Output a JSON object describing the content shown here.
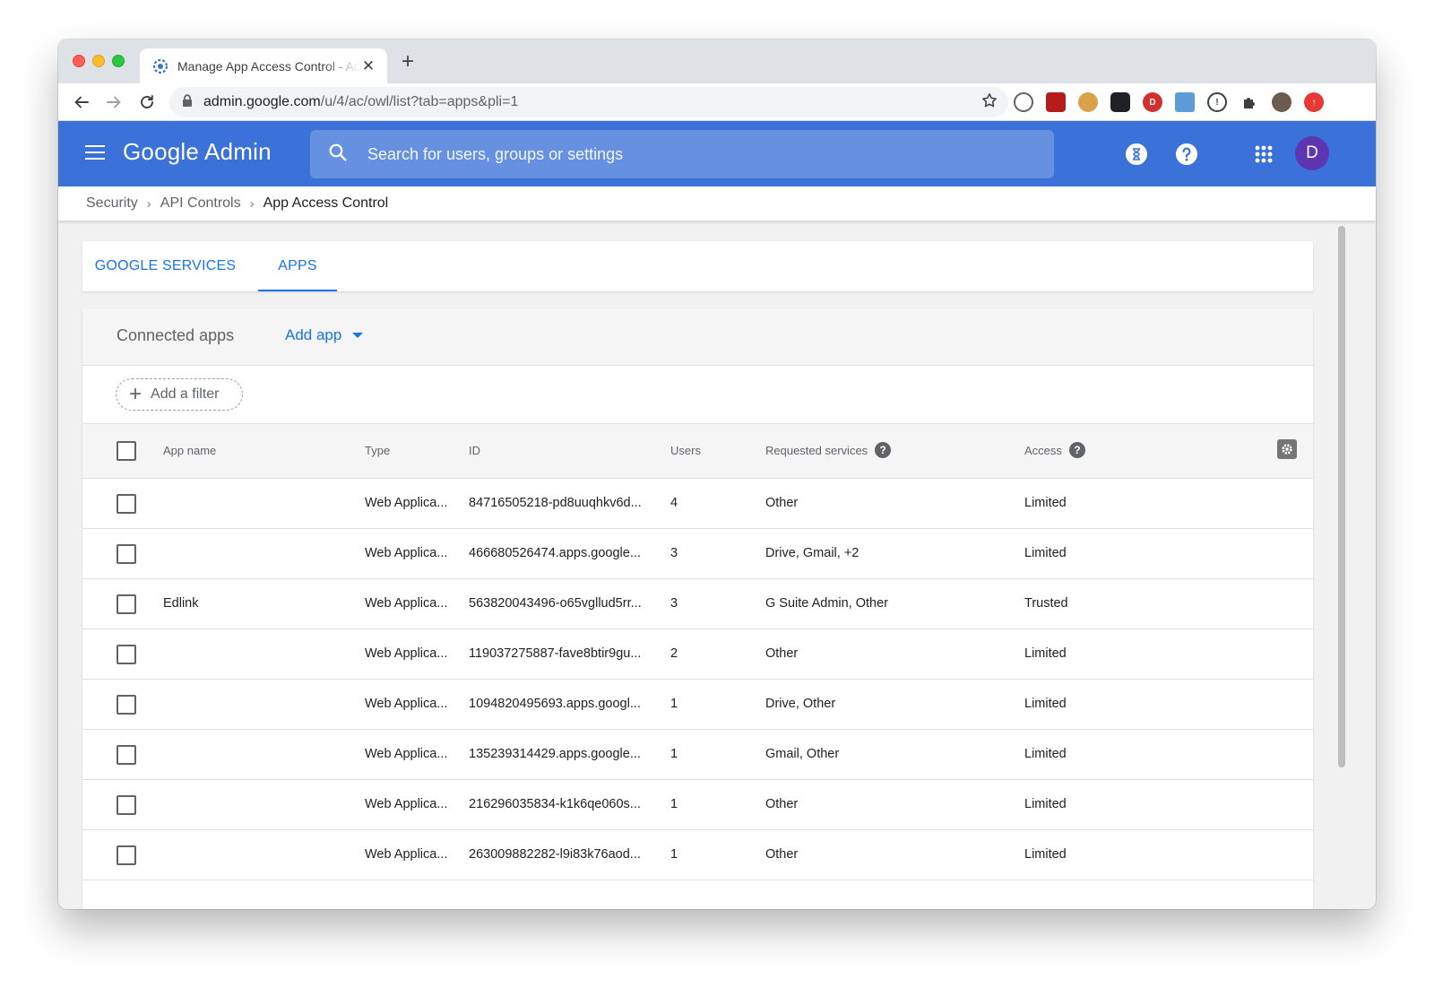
{
  "browser": {
    "tab_title": "Manage App Access Control - Admin Console",
    "new_tab": "+",
    "url_host": "admin.google.com",
    "url_path": "/u/4/ac/owl/list?tab=apps&pli=1",
    "avatar_letter": "D"
  },
  "header": {
    "brand": "Google Admin",
    "search_placeholder": "Search for users, groups or settings",
    "avatar_letter": "D",
    "brand_color": "#3b72d9"
  },
  "breadcrumb": [
    "Security",
    "API Controls",
    "App Access Control"
  ],
  "tabs": [
    "GOOGLE SERVICES",
    "APPS"
  ],
  "active_tab": "APPS",
  "apps_panel": {
    "title": "Connected apps",
    "add_app": "Add app",
    "add_filter": "Add a filter"
  },
  "table": {
    "columns": [
      "App name",
      "Type",
      "ID",
      "Users",
      "Requested services",
      "Access"
    ],
    "rows": [
      {
        "name": "",
        "type": "Web Applica...",
        "id": "84716505218-pd8uuqhkv6d...",
        "users": "4",
        "services": "Other",
        "access": "Limited"
      },
      {
        "name": "",
        "type": "Web Applica...",
        "id": "466680526474.apps.google...",
        "users": "3",
        "services": "Drive, Gmail, +2",
        "access": "Limited"
      },
      {
        "name": "Edlink",
        "type": "Web Applica...",
        "id": "563820043496-o65vgllud5rr...",
        "users": "3",
        "services": "G Suite Admin, Other",
        "access": "Trusted"
      },
      {
        "name": "",
        "type": "Web Applica...",
        "id": "119037275887-fave8btir9gu...",
        "users": "2",
        "services": "Other",
        "access": "Limited"
      },
      {
        "name": "",
        "type": "Web Applica...",
        "id": "1094820495693.apps.googl...",
        "users": "1",
        "services": "Drive, Other",
        "access": "Limited"
      },
      {
        "name": "",
        "type": "Web Applica...",
        "id": "135239314429.apps.google...",
        "users": "1",
        "services": "Gmail, Other",
        "access": "Limited"
      },
      {
        "name": "",
        "type": "Web Applica...",
        "id": "216296035834-k1k6qe060s...",
        "users": "1",
        "services": "Other",
        "access": "Limited"
      },
      {
        "name": "",
        "type": "Web Applica...",
        "id": "263009882282-l9i83k76aod...",
        "users": "1",
        "services": "Other",
        "access": "Limited"
      }
    ]
  }
}
